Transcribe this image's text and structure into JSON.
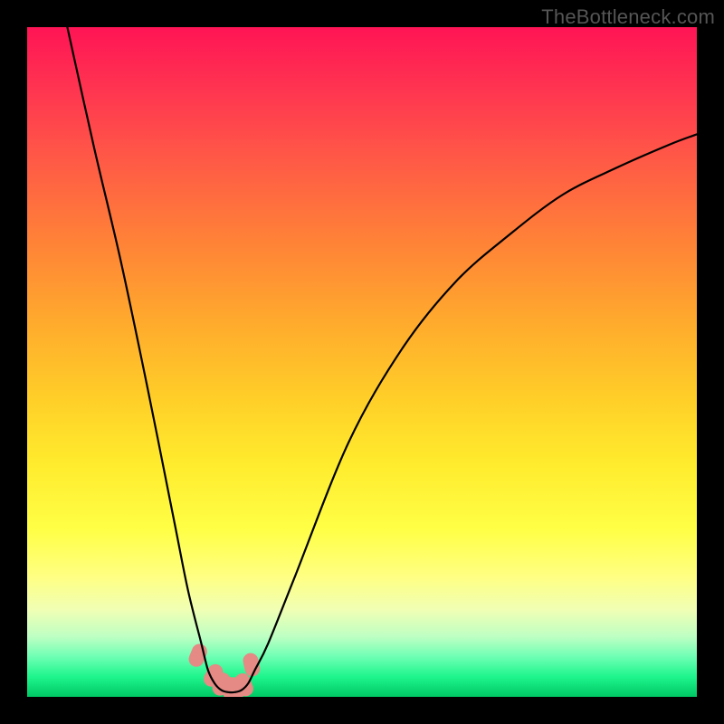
{
  "watermark": "TheBottleneck.com",
  "chart_data": {
    "type": "line",
    "title": "",
    "xlabel": "",
    "ylabel": "",
    "xlim": [
      0,
      100
    ],
    "ylim": [
      0,
      100
    ],
    "grid": false,
    "series": [
      {
        "name": "bottleneck-curve",
        "x": [
          6,
          10,
          14,
          18,
          22,
          24,
          26,
          27,
          28,
          29,
          30,
          31,
          32,
          33,
          34,
          36,
          40,
          48,
          56,
          64,
          72,
          80,
          88,
          96,
          100
        ],
        "y": [
          100,
          82,
          65,
          46,
          26,
          16,
          8,
          4,
          2,
          1,
          0.7,
          0.7,
          1,
          2,
          4,
          8,
          18,
          38,
          52,
          62,
          69,
          75,
          79,
          82.5,
          84
        ]
      }
    ],
    "markers": {
      "name": "highlight-dots",
      "x": [
        25.5,
        27.8,
        29.0,
        30.4,
        31.1,
        32.4,
        33.5
      ],
      "y": [
        6.2,
        3.2,
        1.9,
        1.2,
        1.2,
        1.8,
        4.8
      ],
      "color": "#e58a84",
      "radius_px": 13
    },
    "background": "rainbow-vertical-gradient (red top → green bottom)"
  }
}
